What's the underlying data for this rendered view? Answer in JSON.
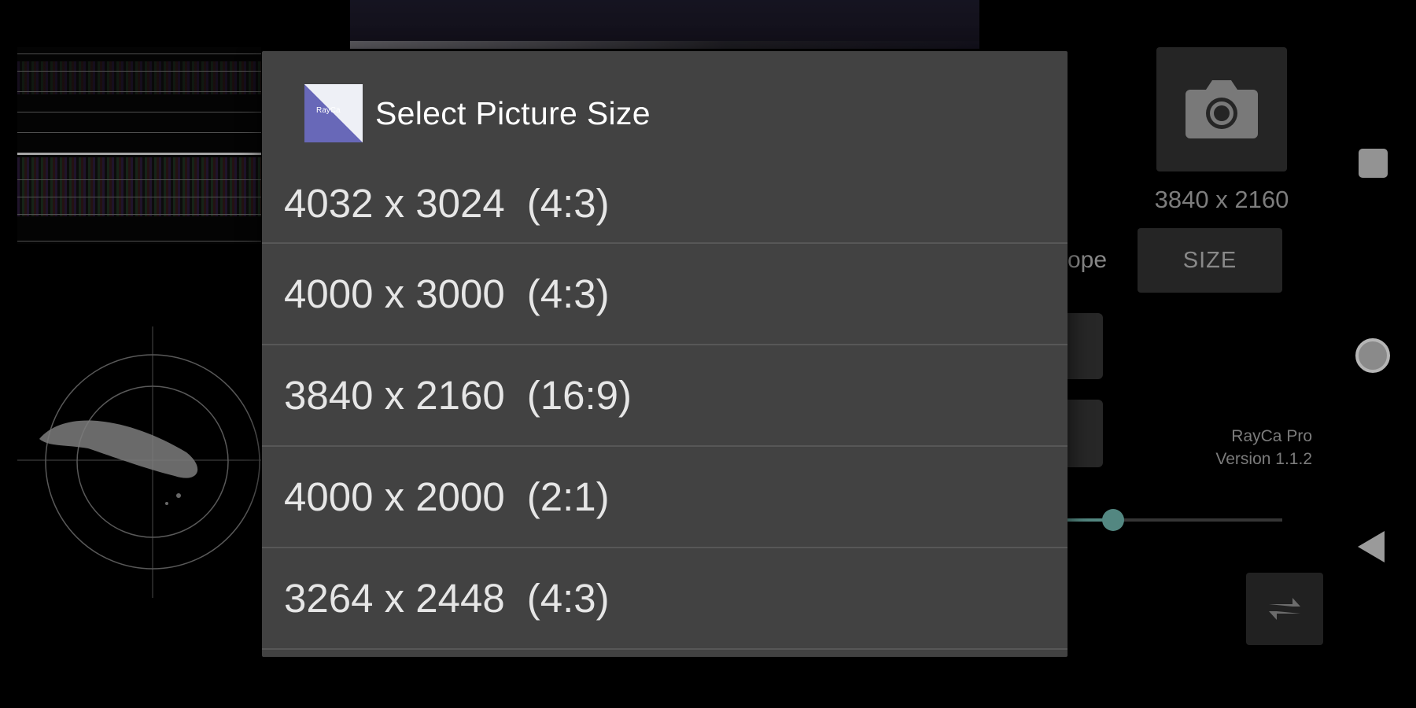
{
  "background": {
    "current_size": "3840 x 2160",
    "size_button_label": "SIZE",
    "scope_label_partial": "cope",
    "app_name": "RayCa Pro",
    "app_version": "Version 1.1.2",
    "slider_level": 0.26,
    "accent_color": "#5f9a93"
  },
  "dialog": {
    "icon": "rayca-app-icon",
    "icon_text": "RayCa",
    "title": "Select Picture Size",
    "options": [
      {
        "resolution": "4032 x 3024",
        "ratio": "(4:3)"
      },
      {
        "resolution": "4000 x 3000",
        "ratio": "(4:3)"
      },
      {
        "resolution": "3840 x 2160",
        "ratio": "(16:9)"
      },
      {
        "resolution": "4000 x 2000",
        "ratio": "(2:1)"
      },
      {
        "resolution": "3264 x 2448",
        "ratio": "(4:3)"
      }
    ]
  },
  "nav": {
    "recents_icon": "square-icon",
    "home_icon": "circle-icon",
    "back_icon": "triangle-back-icon"
  }
}
